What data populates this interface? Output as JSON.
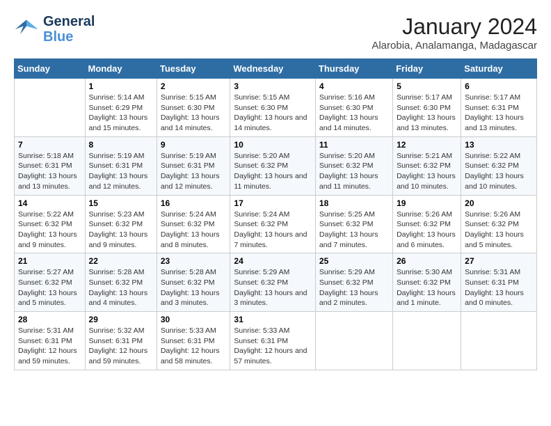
{
  "logo": {
    "text_general": "General",
    "text_blue": "Blue"
  },
  "title": "January 2024",
  "location": "Alarobia, Analamanga, Madagascar",
  "weekdays": [
    "Sunday",
    "Monday",
    "Tuesday",
    "Wednesday",
    "Thursday",
    "Friday",
    "Saturday"
  ],
  "weeks": [
    [
      {
        "day": "",
        "info": ""
      },
      {
        "day": "1",
        "info": "Sunrise: 5:14 AM\nSunset: 6:29 PM\nDaylight: 13 hours\nand 15 minutes."
      },
      {
        "day": "2",
        "info": "Sunrise: 5:15 AM\nSunset: 6:30 PM\nDaylight: 13 hours\nand 14 minutes."
      },
      {
        "day": "3",
        "info": "Sunrise: 5:15 AM\nSunset: 6:30 PM\nDaylight: 13 hours\nand 14 minutes."
      },
      {
        "day": "4",
        "info": "Sunrise: 5:16 AM\nSunset: 6:30 PM\nDaylight: 13 hours\nand 14 minutes."
      },
      {
        "day": "5",
        "info": "Sunrise: 5:17 AM\nSunset: 6:30 PM\nDaylight: 13 hours\nand 13 minutes."
      },
      {
        "day": "6",
        "info": "Sunrise: 5:17 AM\nSunset: 6:31 PM\nDaylight: 13 hours\nand 13 minutes."
      }
    ],
    [
      {
        "day": "7",
        "info": "Sunrise: 5:18 AM\nSunset: 6:31 PM\nDaylight: 13 hours\nand 13 minutes."
      },
      {
        "day": "8",
        "info": "Sunrise: 5:19 AM\nSunset: 6:31 PM\nDaylight: 13 hours\nand 12 minutes."
      },
      {
        "day": "9",
        "info": "Sunrise: 5:19 AM\nSunset: 6:31 PM\nDaylight: 13 hours\nand 12 minutes."
      },
      {
        "day": "10",
        "info": "Sunrise: 5:20 AM\nSunset: 6:32 PM\nDaylight: 13 hours\nand 11 minutes."
      },
      {
        "day": "11",
        "info": "Sunrise: 5:20 AM\nSunset: 6:32 PM\nDaylight: 13 hours\nand 11 minutes."
      },
      {
        "day": "12",
        "info": "Sunrise: 5:21 AM\nSunset: 6:32 PM\nDaylight: 13 hours\nand 10 minutes."
      },
      {
        "day": "13",
        "info": "Sunrise: 5:22 AM\nSunset: 6:32 PM\nDaylight: 13 hours\nand 10 minutes."
      }
    ],
    [
      {
        "day": "14",
        "info": "Sunrise: 5:22 AM\nSunset: 6:32 PM\nDaylight: 13 hours\nand 9 minutes."
      },
      {
        "day": "15",
        "info": "Sunrise: 5:23 AM\nSunset: 6:32 PM\nDaylight: 13 hours\nand 9 minutes."
      },
      {
        "day": "16",
        "info": "Sunrise: 5:24 AM\nSunset: 6:32 PM\nDaylight: 13 hours\nand 8 minutes."
      },
      {
        "day": "17",
        "info": "Sunrise: 5:24 AM\nSunset: 6:32 PM\nDaylight: 13 hours\nand 7 minutes."
      },
      {
        "day": "18",
        "info": "Sunrise: 5:25 AM\nSunset: 6:32 PM\nDaylight: 13 hours\nand 7 minutes."
      },
      {
        "day": "19",
        "info": "Sunrise: 5:26 AM\nSunset: 6:32 PM\nDaylight: 13 hours\nand 6 minutes."
      },
      {
        "day": "20",
        "info": "Sunrise: 5:26 AM\nSunset: 6:32 PM\nDaylight: 13 hours\nand 5 minutes."
      }
    ],
    [
      {
        "day": "21",
        "info": "Sunrise: 5:27 AM\nSunset: 6:32 PM\nDaylight: 13 hours\nand 5 minutes."
      },
      {
        "day": "22",
        "info": "Sunrise: 5:28 AM\nSunset: 6:32 PM\nDaylight: 13 hours\nand 4 minutes."
      },
      {
        "day": "23",
        "info": "Sunrise: 5:28 AM\nSunset: 6:32 PM\nDaylight: 13 hours\nand 3 minutes."
      },
      {
        "day": "24",
        "info": "Sunrise: 5:29 AM\nSunset: 6:32 PM\nDaylight: 13 hours\nand 3 minutes."
      },
      {
        "day": "25",
        "info": "Sunrise: 5:29 AM\nSunset: 6:32 PM\nDaylight: 13 hours\nand 2 minutes."
      },
      {
        "day": "26",
        "info": "Sunrise: 5:30 AM\nSunset: 6:32 PM\nDaylight: 13 hours\nand 1 minute."
      },
      {
        "day": "27",
        "info": "Sunrise: 5:31 AM\nSunset: 6:31 PM\nDaylight: 13 hours\nand 0 minutes."
      }
    ],
    [
      {
        "day": "28",
        "info": "Sunrise: 5:31 AM\nSunset: 6:31 PM\nDaylight: 12 hours\nand 59 minutes."
      },
      {
        "day": "29",
        "info": "Sunrise: 5:32 AM\nSunset: 6:31 PM\nDaylight: 12 hours\nand 59 minutes."
      },
      {
        "day": "30",
        "info": "Sunrise: 5:33 AM\nSunset: 6:31 PM\nDaylight: 12 hours\nand 58 minutes."
      },
      {
        "day": "31",
        "info": "Sunrise: 5:33 AM\nSunset: 6:31 PM\nDaylight: 12 hours\nand 57 minutes."
      },
      {
        "day": "",
        "info": ""
      },
      {
        "day": "",
        "info": ""
      },
      {
        "day": "",
        "info": ""
      }
    ]
  ]
}
